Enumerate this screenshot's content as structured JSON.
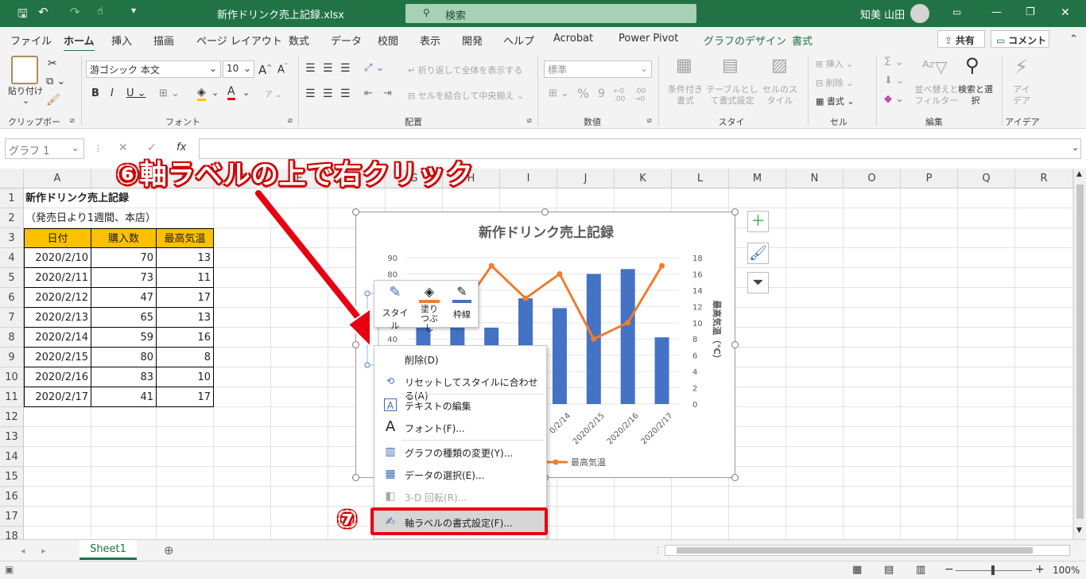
{
  "titlebar": {
    "filename": "新作ドリンク売上記録.xlsx",
    "search": "検索",
    "user": "知美 山田"
  },
  "tabs": [
    "ファイル",
    "ホーム",
    "挿入",
    "描画",
    "ページ レイアウト",
    "数式",
    "データ",
    "校閲",
    "表示",
    "開発",
    "ヘルプ",
    "Acrobat",
    "Power Pivot",
    "グラフのデザイン",
    "書式"
  ],
  "share": "共有",
  "comment": "コメント",
  "ribbon": {
    "paste": "貼り付け",
    "clipboard": "クリップボード",
    "font_name": "游ゴシック 本文",
    "font_size": "10",
    "font_group": "フォント",
    "wrap": "折り返して全体を表示する",
    "merge": "セルを結合して中央揃え",
    "alignment": "配置",
    "number_format": "標準",
    "number": "数値",
    "cond_format": "条件付き書式",
    "table_format": "テーブルとして書式設定",
    "cell_style": "セルのスタイル",
    "styles": "スタイル",
    "insert": "挿入",
    "delete": "削除",
    "format": "書式",
    "cells": "セル",
    "sort": "並べ替えとフィルター",
    "find": "検索と選択",
    "editing": "編集",
    "ideas": "アイデア",
    "ideas_group": "アイデア"
  },
  "namebox": "グラフ 1",
  "columns": [
    "A",
    "B",
    "C",
    "D",
    "E",
    "F",
    "G",
    "H",
    "I",
    "J",
    "K",
    "L",
    "M",
    "N",
    "O",
    "P",
    "Q",
    "R"
  ],
  "rows": [
    "1",
    "2",
    "3",
    "4",
    "5",
    "6",
    "7",
    "8",
    "9",
    "10",
    "11",
    "12",
    "13",
    "14",
    "15",
    "16",
    "17",
    "18"
  ],
  "sheet": {
    "title": "新作ドリンク売上記録",
    "subtitle": "（発売日より1週間、本店）",
    "headers": [
      "日付",
      "購入数",
      "最高気温"
    ],
    "data": [
      [
        "2020/2/10",
        "70",
        "13"
      ],
      [
        "2020/2/11",
        "73",
        "11"
      ],
      [
        "2020/2/12",
        "47",
        "17"
      ],
      [
        "2020/2/13",
        "65",
        "13"
      ],
      [
        "2020/2/14",
        "59",
        "16"
      ],
      [
        "2020/2/15",
        "80",
        "8"
      ],
      [
        "2020/2/16",
        "83",
        "10"
      ],
      [
        "2020/2/17",
        "41",
        "17"
      ]
    ]
  },
  "chart_data": {
    "type": "bar",
    "title": "新作ドリンク売上記録",
    "categories": [
      "2020/2/10",
      "2020/2/11",
      "2020/2/12",
      "2020/2/13",
      "2020/2/14",
      "2020/2/15",
      "2020/2/16",
      "2020/2/17"
    ],
    "series": [
      {
        "name": "購入数",
        "type": "bar",
        "axis": "left",
        "values": [
          70,
          73,
          47,
          65,
          59,
          80,
          83,
          41
        ]
      },
      {
        "name": "最高気温",
        "type": "line",
        "axis": "right",
        "values": [
          13,
          11,
          17,
          13,
          16,
          8,
          10,
          17
        ]
      }
    ],
    "y_left_ticks": [
      "90",
      "80",
      "70",
      "60",
      "50",
      "40"
    ],
    "y_right_ticks": [
      "18",
      "16",
      "14",
      "12",
      "10",
      "8",
      "6",
      "4",
      "2",
      "0"
    ],
    "y_left_lim": [
      0,
      90
    ],
    "y_right_lim": [
      0,
      18
    ],
    "y_right_label": "最高気温（℃）",
    "visible_x_labels": [
      "0/2/14",
      "2020/2/15",
      "2020/2/16",
      "2020/2/17"
    ],
    "legend_visible": "最高気温",
    "colors": {
      "bar": "#4472c4",
      "line": "#ed7d31"
    }
  },
  "mini_toolbar": {
    "style": "スタイル",
    "fill": "塗りつぶし",
    "outline": "枠線"
  },
  "context_menu": [
    {
      "label": "削除(D)",
      "disabled": false
    },
    {
      "label": "リセットしてスタイルに合わせる(A)",
      "disabled": false
    },
    {
      "label": "テキストの編集",
      "disabled": false
    },
    {
      "label": "フォント(F)...",
      "disabled": false
    },
    {
      "label": "グラフの種類の変更(Y)...",
      "disabled": false
    },
    {
      "label": "データの選択(E)...",
      "disabled": false
    },
    {
      "label": "3-D 回転(R)...",
      "disabled": true
    },
    {
      "label": "軸ラベルの書式設定(F)...",
      "disabled": false
    }
  ],
  "callouts": {
    "step6": "⑥軸ラベルの上で右クリック",
    "step7": "⑦"
  },
  "sheet_tab": "Sheet1",
  "zoom": "100%"
}
